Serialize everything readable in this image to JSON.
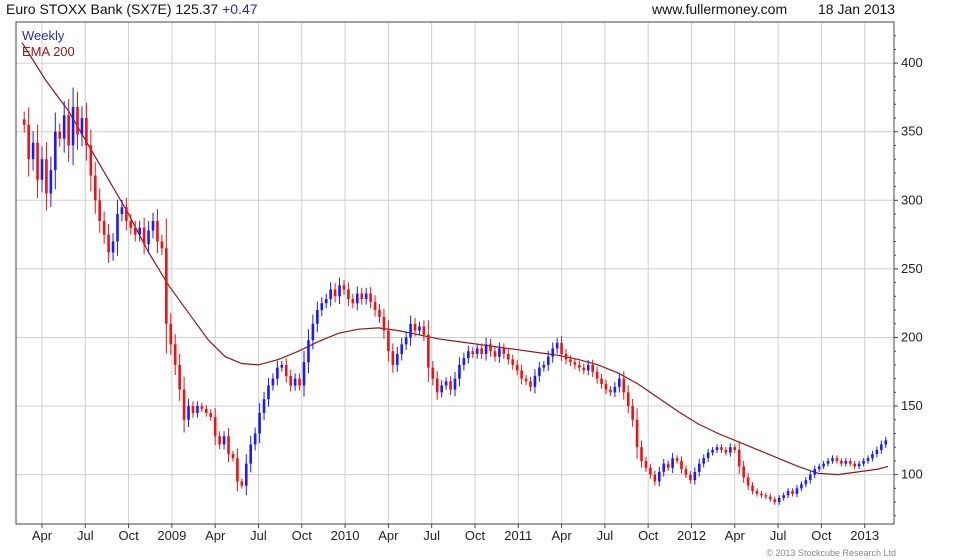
{
  "header": {
    "title": "Euro STOXX Bank (SX7E)",
    "last": "125.37",
    "change": "+0.47",
    "site": "www.fullermoney.com",
    "date": "18 Jan 2013"
  },
  "legend": {
    "period": "Weekly",
    "ema": "EMA 200"
  },
  "credit": "© 2013 Stockcube Research Ltd",
  "colors": {
    "up": "#1a1aff",
    "down": "#ee1111",
    "ema": "#8b1a1a",
    "grid": "#cfcfcf",
    "frame": "#444444",
    "change": "#2a2aa8"
  },
  "chart_data": {
    "type": "candlestick",
    "frequency": "weekly",
    "title": "Euro STOXX Bank (SX7E) 125.37 +0.47",
    "ylim": [
      64,
      430
    ],
    "y_ticks": [
      100,
      150,
      200,
      250,
      300,
      350,
      400
    ],
    "x_range": [
      0,
      260
    ],
    "x_ticks": [
      {
        "w": 6,
        "label": "Apr"
      },
      {
        "w": 19,
        "label": "Jul"
      },
      {
        "w": 32,
        "label": "Oct"
      },
      {
        "w": 45,
        "label": "2009"
      },
      {
        "w": 58,
        "label": "Apr"
      },
      {
        "w": 71,
        "label": "Jul"
      },
      {
        "w": 84,
        "label": "Oct"
      },
      {
        "w": 97,
        "label": "2010"
      },
      {
        "w": 110,
        "label": "Apr"
      },
      {
        "w": 123,
        "label": "Jul"
      },
      {
        "w": 136,
        "label": "Oct"
      },
      {
        "w": 149,
        "label": "2011"
      },
      {
        "w": 162,
        "label": "Apr"
      },
      {
        "w": 175,
        "label": "Jul"
      },
      {
        "w": 188,
        "label": "Oct"
      },
      {
        "w": 201,
        "label": "2012"
      },
      {
        "w": 214,
        "label": "Apr"
      },
      {
        "w": 227,
        "label": "Jul"
      },
      {
        "w": 240,
        "label": "Oct"
      },
      {
        "w": 253,
        "label": "2013"
      }
    ],
    "grid": true,
    "series": [
      {
        "name": "Euro STOXX Bank (SX7E)",
        "style": "candles",
        "closes": [
          355,
          330,
          342,
          315,
          330,
          305,
          322,
          350,
          345,
          362,
          340,
          368,
          348,
          360,
          340,
          318,
          300,
          285,
          275,
          262,
          270,
          290,
          295,
          285,
          280,
          275,
          280,
          268,
          278,
          285,
          270,
          265,
          210,
          195,
          180,
          162,
          140,
          150,
          145,
          150,
          148,
          145,
          142,
          128,
          122,
          128,
          115,
          112,
          95,
          92,
          108,
          122,
          130,
          145,
          155,
          165,
          170,
          178,
          180,
          172,
          165,
          170,
          165,
          182,
          198,
          210,
          220,
          225,
          228,
          235,
          230,
          238,
          235,
          228,
          225,
          232,
          228,
          232,
          226,
          220,
          215,
          205,
          190,
          180,
          188,
          195,
          200,
          210,
          205,
          208,
          202,
          178,
          170,
          160,
          165,
          168,
          162,
          170,
          180,
          185,
          190,
          188,
          192,
          188,
          195,
          190,
          186,
          192,
          188,
          184,
          180,
          176,
          170,
          168,
          164,
          172,
          178,
          180,
          186,
          192,
          196,
          188,
          184,
          182,
          180,
          178,
          176,
          180,
          175,
          170,
          166,
          162,
          160,
          164,
          170,
          160,
          150,
          140,
          120,
          110,
          105,
          100,
          95,
          102,
          108,
          105,
          112,
          110,
          104,
          100,
          96,
          102,
          108,
          112,
          116,
          118,
          120,
          118,
          116,
          120,
          118,
          106,
          98,
          92,
          88,
          86,
          85,
          84,
          82,
          80,
          83,
          85,
          88,
          86,
          90,
          93,
          96,
          100,
          104,
          106,
          108,
          110,
          112,
          110,
          108,
          110,
          108,
          106,
          108,
          110,
          112,
          115,
          118,
          122,
          125
        ]
      },
      {
        "name": "EMA 200",
        "style": "line",
        "points": [
          [
            0,
            415
          ],
          [
            7,
            388
          ],
          [
            14,
            365
          ],
          [
            20,
            340
          ],
          [
            26,
            315
          ],
          [
            32,
            290
          ],
          [
            38,
            262
          ],
          [
            44,
            238
          ],
          [
            50,
            218
          ],
          [
            56,
            198
          ],
          [
            61,
            186
          ],
          [
            66,
            181
          ],
          [
            71,
            180
          ],
          [
            77,
            184
          ],
          [
            83,
            190
          ],
          [
            89,
            197
          ],
          [
            95,
            203
          ],
          [
            101,
            206
          ],
          [
            107,
            207
          ],
          [
            113,
            205
          ],
          [
            119,
            202
          ],
          [
            125,
            199
          ],
          [
            131,
            197
          ],
          [
            137,
            195
          ],
          [
            143,
            193
          ],
          [
            149,
            191
          ],
          [
            155,
            189
          ],
          [
            161,
            187
          ],
          [
            167,
            184
          ],
          [
            173,
            180
          ],
          [
            179,
            174
          ],
          [
            185,
            166
          ],
          [
            191,
            156
          ],
          [
            197,
            146
          ],
          [
            203,
            137
          ],
          [
            209,
            130
          ],
          [
            215,
            124
          ],
          [
            221,
            118
          ],
          [
            227,
            112
          ],
          [
            233,
            106
          ],
          [
            239,
            101
          ],
          [
            245,
            100
          ],
          [
            251,
            102
          ],
          [
            257,
            104
          ],
          [
            260,
            106
          ]
        ]
      }
    ]
  }
}
